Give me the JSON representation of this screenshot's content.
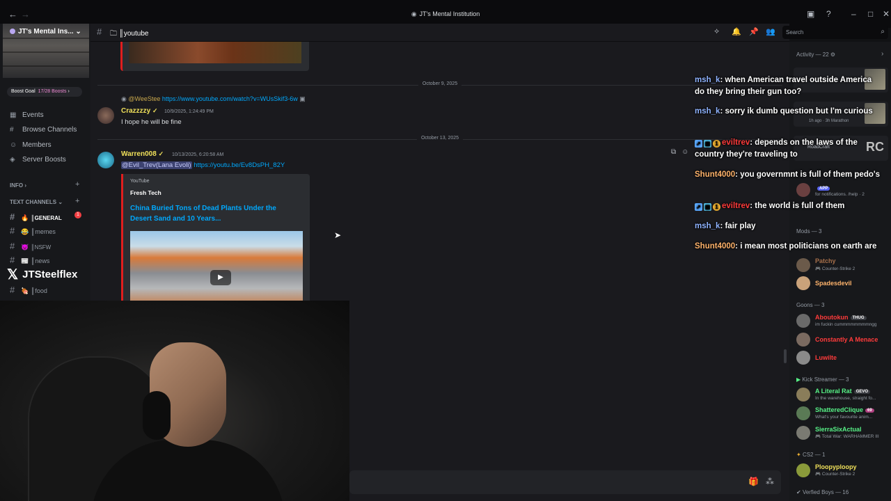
{
  "window": {
    "title": "JT's Mental Institution"
  },
  "server": {
    "name": "JT's Mental Ins...",
    "boost_goal": "Boost Goal",
    "boost_progress": "17/28 Boosts"
  },
  "nav": [
    {
      "label": "Events",
      "icon": "calendar-icon"
    },
    {
      "label": "Browse Channels",
      "icon": "browse-channels-icon"
    },
    {
      "label": "Members",
      "icon": "members-icon"
    },
    {
      "label": "Server Boosts",
      "icon": "boost-icon"
    }
  ],
  "categories": {
    "info": "INFO",
    "text_channels": "TEXT CHANNELS"
  },
  "channels": [
    {
      "emoji": "🔥",
      "label": "║GENERAL",
      "badge": "1"
    },
    {
      "emoji": "😂",
      "label": "║memes"
    },
    {
      "emoji": "👿",
      "label": "║NSFW"
    },
    {
      "emoji": "📰",
      "label": "║news"
    },
    {
      "emoji": "🍖",
      "label": "║food"
    }
  ],
  "overlay_handle": "JTSteelflex",
  "header": {
    "channel": "║youtube",
    "search_placeholder": "Search"
  },
  "chat": {
    "date1": "October 9, 2025",
    "date2": "October 13, 2025",
    "reply": {
      "name": "@WeeStee",
      "link": "https://www.youtube.com/watch?v=WUsSkif3-6w"
    },
    "msg1": {
      "author": "Crazzzzy",
      "time": "10/9/2025, 1:24:49 PM",
      "text": "I hope he will be fine"
    },
    "msg2": {
      "author": "Warren008",
      "time": "10/13/2025, 6:20:58 AM",
      "mention": "@Evil_Trev(Lana Evoli)",
      "link": "https://youtu.be/Ev8DsPH_82Y"
    },
    "embed": {
      "provider": "YouTube",
      "author": "Fresh Tech",
      "title": "China Buried Tons of Dead Plants Under the Desert Sand and 10 Years..."
    }
  },
  "overlay_chat": [
    {
      "user": "msh_k",
      "text": ": when American travel outside America do they bring their gun too?",
      "cls": "u1",
      "badges": false
    },
    {
      "user": "msh_k",
      "text": ": sorry ik dumb question but I'm curious",
      "cls": "u1",
      "badges": false
    },
    {
      "user": "eviltrev",
      "text": ": depends on the laws of the country they're traveling to",
      "cls": "u3",
      "badges": true
    },
    {
      "user": "Shunt4000",
      "text": ": you governmnt is full of them pedo's",
      "cls": "u2",
      "badges": false
    },
    {
      "user": "eviltrev",
      "text": ": the world is full of them",
      "cls": "u3",
      "badges": true
    },
    {
      "user": "msh_k",
      "text": ": fair play",
      "cls": "u1",
      "badges": false
    },
    {
      "user": "Shunt4000",
      "text": ": i mean most politicians on earth are",
      "cls": "u2",
      "badges": false
    }
  ],
  "members": {
    "activity": "Activity — 22",
    "mods": "Mods — 3",
    "goons": "Goons — 3",
    "kick": "Kick Streamer — 3",
    "cs2": "CS2 — 1",
    "verified": "Verfied Boys — 16",
    "partial": {
      "app_tag": "APP",
      "partial_status": "for notifications. /help · 2",
      "roadcraft": "RoadCraft",
      "marathon": "1h ago · 3h Marathon"
    },
    "list": [
      {
        "name": "Patchy",
        "status": "Counter-Strike 2",
        "color": "#a66f4a",
        "av": "#6b5a4a"
      },
      {
        "name": "Spadesdevil",
        "status": "",
        "color": "#ffb36b",
        "av": "#c9a27a"
      },
      {
        "name": "Aboutokun",
        "status": "im fuckin cummmmmmmmngg",
        "color": "#ff3b3b",
        "av": "#6a6a6a",
        "tag": "THUG"
      },
      {
        "name": "Constantly A Menace",
        "status": "",
        "color": "#ff3b3b",
        "av": "#7a6a60"
      },
      {
        "name": "Luwilte",
        "status": "",
        "color": "#ff3b3b",
        "av": "#8a8a8a"
      },
      {
        "name": "A Literal Rat",
        "status": "In the warehouse, straight fo...",
        "color": "#57f287",
        "av": "#8a7d5a",
        "tag": "GEVO"
      },
      {
        "name": "ShatteredClique",
        "status": "What's your favourite anim...",
        "color": "#57f287",
        "av": "#5a7a55",
        "tag": "69"
      },
      {
        "name": "SierraSixActual",
        "status": "Total War: WARHAMMER III",
        "color": "#57f287",
        "av": "#7a7a72"
      },
      {
        "name": "Ploopyploopy",
        "status": "Counter-Strike 2",
        "color": "#f0e05a",
        "av": "#8a9a3a"
      }
    ]
  }
}
